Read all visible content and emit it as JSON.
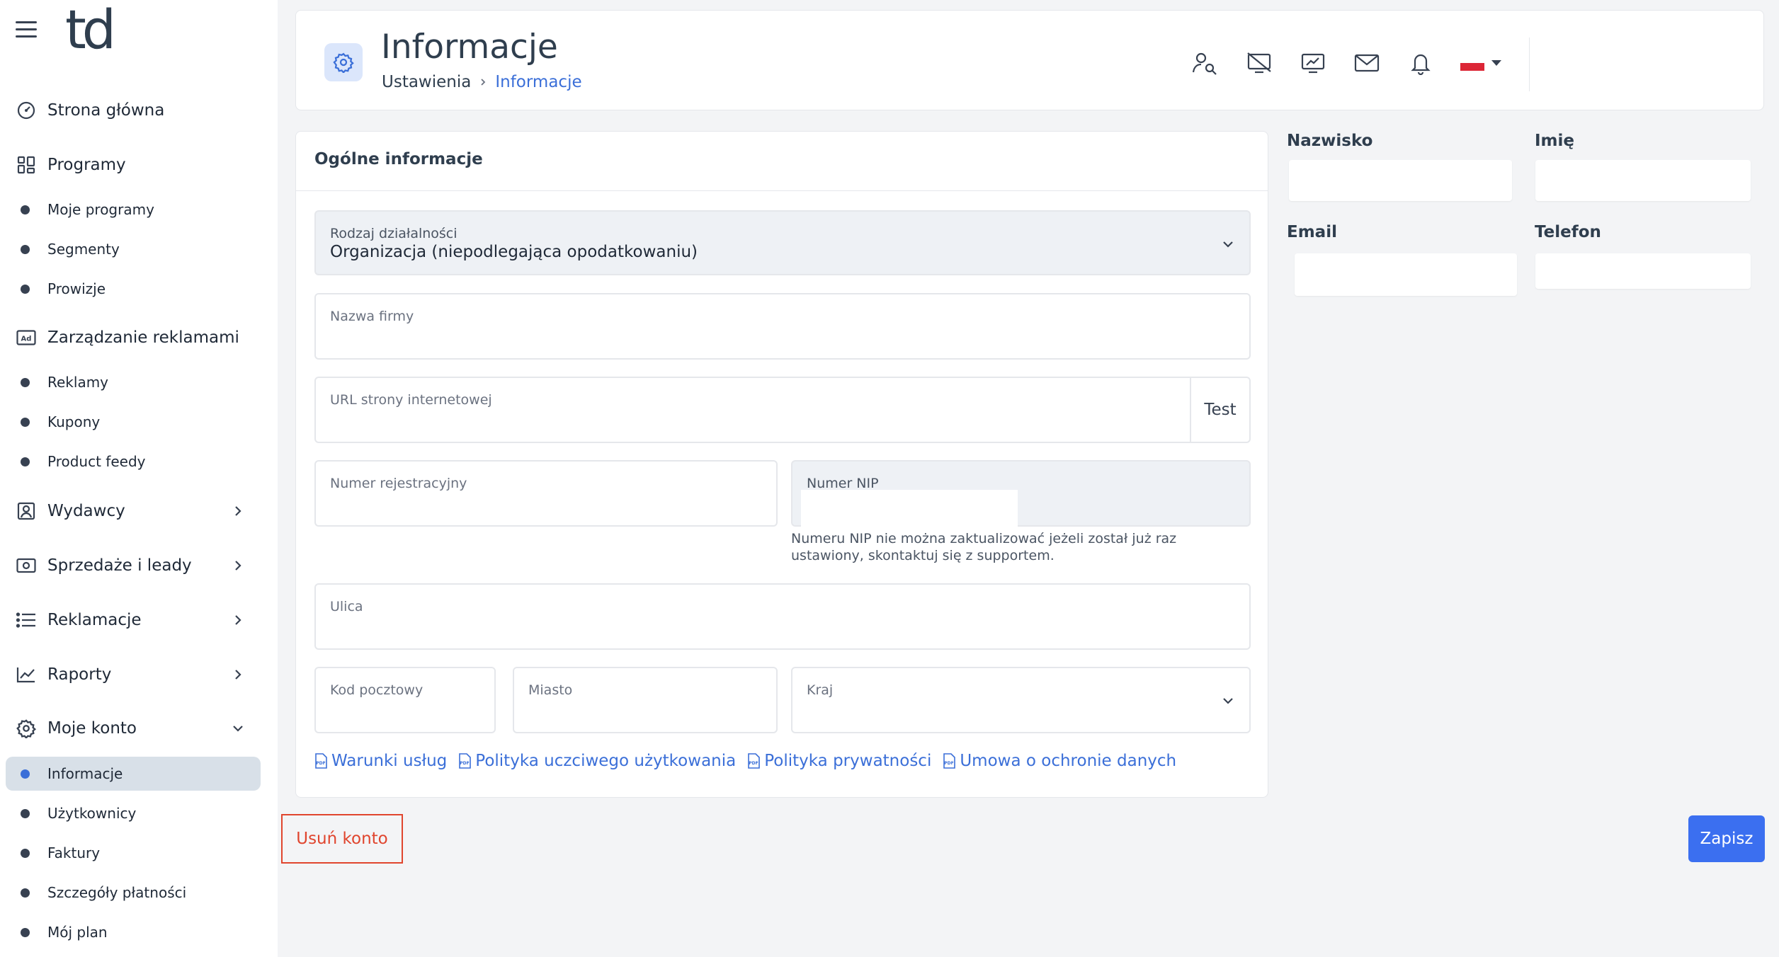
{
  "sidebar": {
    "logo": "td",
    "items": [
      {
        "label": "Strona główna"
      },
      {
        "label": "Programy"
      },
      {
        "label": "Moje programy"
      },
      {
        "label": "Segmenty"
      },
      {
        "label": "Prowizje"
      },
      {
        "label": "Zarządzanie reklamami"
      },
      {
        "label": "Reklamy"
      },
      {
        "label": "Kupony"
      },
      {
        "label": "Product feedy"
      },
      {
        "label": "Wydawcy"
      },
      {
        "label": "Sprzedaże i leady"
      },
      {
        "label": "Reklamacje"
      },
      {
        "label": "Raporty"
      },
      {
        "label": "Moje konto"
      },
      {
        "label": "Informacje"
      },
      {
        "label": "Użytkownicy"
      },
      {
        "label": "Faktury"
      },
      {
        "label": "Szczegóły płatności"
      },
      {
        "label": "Mój plan"
      }
    ]
  },
  "header": {
    "title": "Informacje",
    "breadcrumb": {
      "parent": "Ustawienia",
      "current": "Informacje"
    }
  },
  "form": {
    "title": "Ogólne informacje",
    "business_type": {
      "label": "Rodzaj działalności",
      "value": "Organizacja (niepodlegająca opodatkowaniu)"
    },
    "company_name": {
      "label": "Nazwa firmy",
      "value": ""
    },
    "website_url": {
      "label": "URL strony internetowej",
      "value": "",
      "test_label": "Test"
    },
    "registration_number": {
      "label": "Numer rejestracyjny",
      "value": ""
    },
    "nip": {
      "label": "Numer NIP",
      "value": "",
      "hint": "Numeru NIP nie można zaktualizować jeżeli został już raz ustawiony, skontaktuj się z supportem."
    },
    "street": {
      "label": "Ulica",
      "value": ""
    },
    "postal_code": {
      "label": "Kod pocztowy",
      "value": ""
    },
    "city": {
      "label": "Miasto",
      "value": ""
    },
    "country": {
      "label": "Kraj",
      "value": ""
    },
    "links": [
      {
        "label": "Warunki usług"
      },
      {
        "label": "Polityka uczciwego użytkowania"
      },
      {
        "label": "Polityka prywatności"
      },
      {
        "label": "Umowa o ochronie danych"
      }
    ]
  },
  "contact": {
    "surname_label": "Nazwisko",
    "name_label": "Imię",
    "email_label": "Email",
    "phone_label": "Telefon"
  },
  "actions": {
    "delete_label": "Usuń konto",
    "save_label": "Zapisz"
  },
  "colors": {
    "accent": "#3b6ff0",
    "link": "#3b6fd8",
    "danger": "#e0452e",
    "active_bg": "#d8e0e8"
  }
}
